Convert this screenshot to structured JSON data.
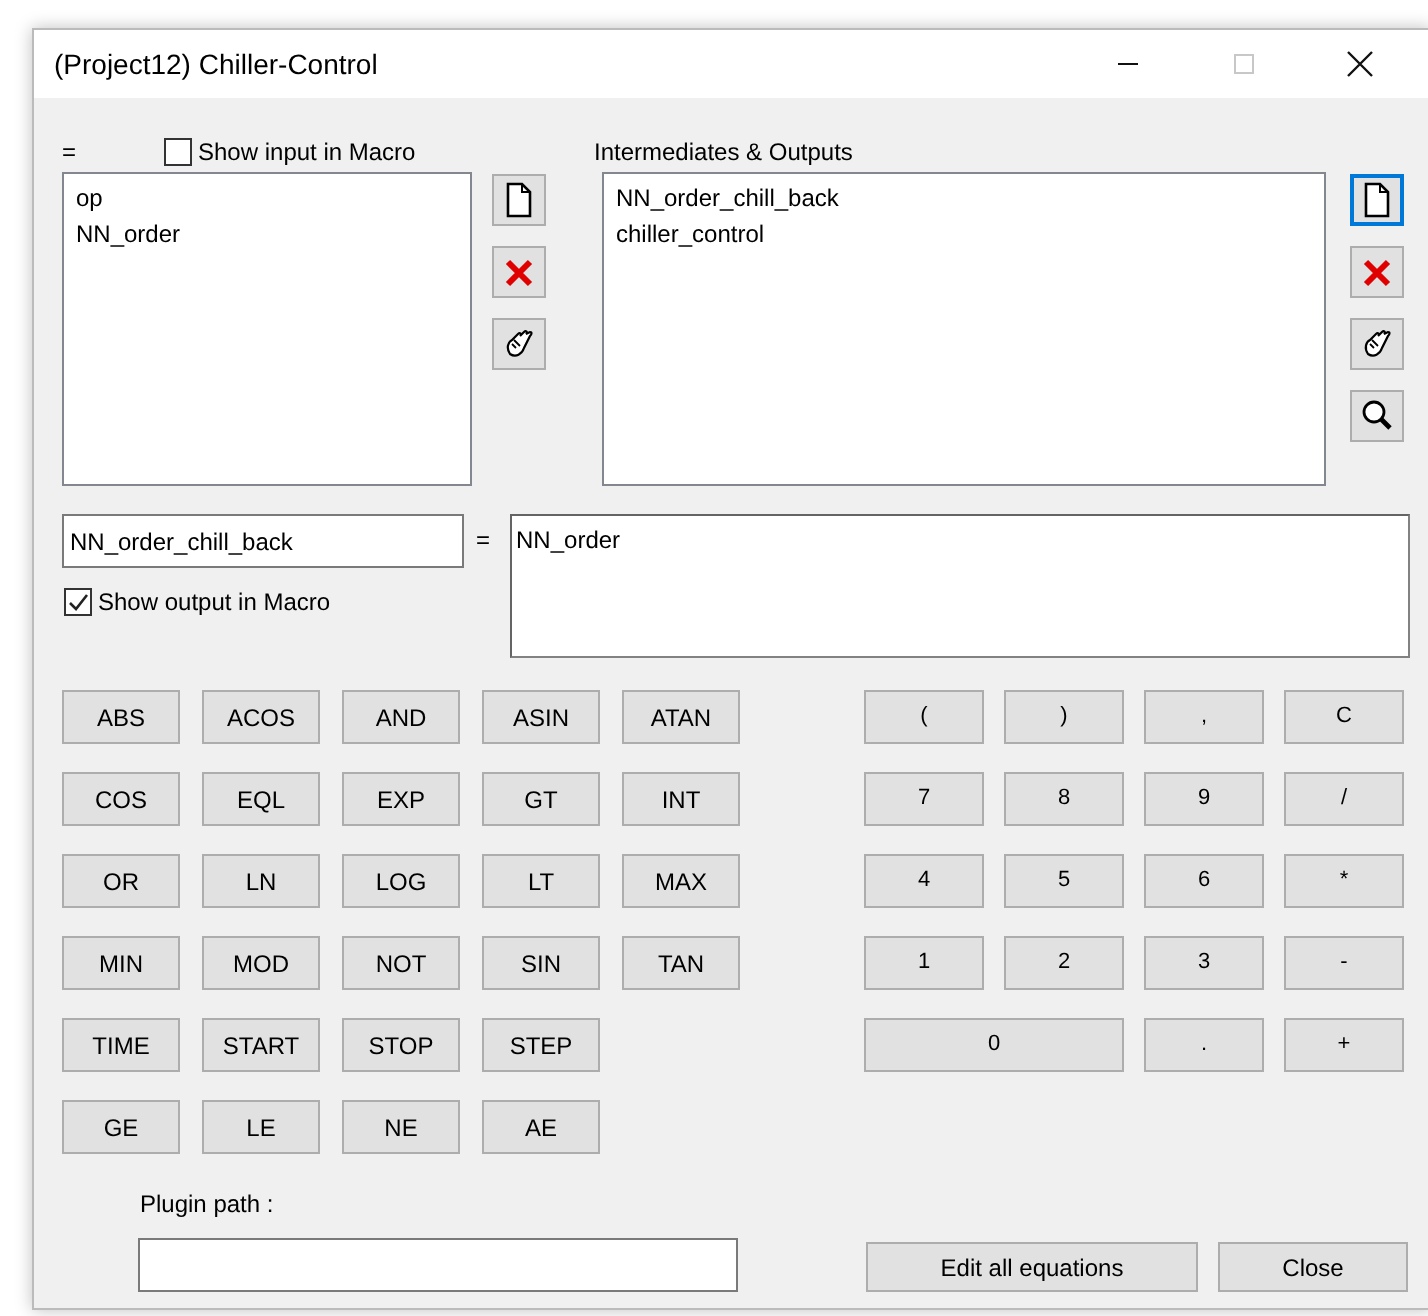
{
  "window": {
    "title": "(Project12) Chiller-Control",
    "controls": [
      {
        "kind": "minimize",
        "disabled": false
      },
      {
        "kind": "maximize",
        "disabled": true
      },
      {
        "kind": "close",
        "disabled": false
      }
    ]
  },
  "inputs": {
    "label": "=",
    "show_in_macro": {
      "label": "Show input in Macro",
      "checked": false
    },
    "items": [
      {
        "text": "op",
        "selected": false
      },
      {
        "text": "NN_order",
        "selected": false
      }
    ],
    "tools": [
      {
        "kind": "new",
        "focused": false
      },
      {
        "kind": "delete",
        "focused": false
      },
      {
        "kind": "edit",
        "focused": false
      }
    ]
  },
  "outputs": {
    "label": "Intermediates & Outputs",
    "items": [
      {
        "text": "NN_order_chill_back",
        "selected": false
      },
      {
        "text": "chiller_control",
        "selected": false
      }
    ],
    "tools": [
      {
        "kind": "new",
        "focused": true
      },
      {
        "kind": "delete",
        "focused": false
      },
      {
        "kind": "edit",
        "focused": false
      },
      {
        "kind": "search",
        "focused": false
      }
    ]
  },
  "equation": {
    "name": "NN_order_chill_back",
    "equals": "=",
    "expression": "NN_order",
    "show_in_macro": {
      "label": "Show output in Macro",
      "checked": true
    }
  },
  "function_keys": [
    [
      "ABS",
      "ACOS",
      "AND",
      "ASIN",
      "ATAN"
    ],
    [
      "COS",
      "EQL",
      "EXP",
      "GT",
      "INT"
    ],
    [
      "OR",
      "LN",
      "LOG",
      "LT",
      "MAX"
    ],
    [
      "MIN",
      "MOD",
      "NOT",
      "SIN",
      "TAN"
    ],
    [
      "TIME",
      "START",
      "STOP",
      "STEP"
    ],
    [
      "GE",
      "LE",
      "NE",
      "AE"
    ]
  ],
  "keypad": [
    {
      "label": "(",
      "wide": false
    },
    {
      "label": ")",
      "wide": false
    },
    {
      "label": ",",
      "wide": false
    },
    {
      "label": "C",
      "wide": false
    },
    {
      "label": "7",
      "wide": false
    },
    {
      "label": "8",
      "wide": false
    },
    {
      "label": "9",
      "wide": false
    },
    {
      "label": "/",
      "wide": false
    },
    {
      "label": "4",
      "wide": false
    },
    {
      "label": "5",
      "wide": false
    },
    {
      "label": "6",
      "wide": false
    },
    {
      "label": "*",
      "wide": false
    },
    {
      "label": "1",
      "wide": false
    },
    {
      "label": "2",
      "wide": false
    },
    {
      "label": "3",
      "wide": false
    },
    {
      "label": "-",
      "wide": false
    },
    {
      "label": "0",
      "wide": true
    },
    {
      "label": ".",
      "wide": false
    },
    {
      "label": "+",
      "wide": false
    }
  ],
  "plugin_path": {
    "label": "Plugin path :"
  },
  "buttons": [
    "Edit all equations",
    "Close"
  ]
}
